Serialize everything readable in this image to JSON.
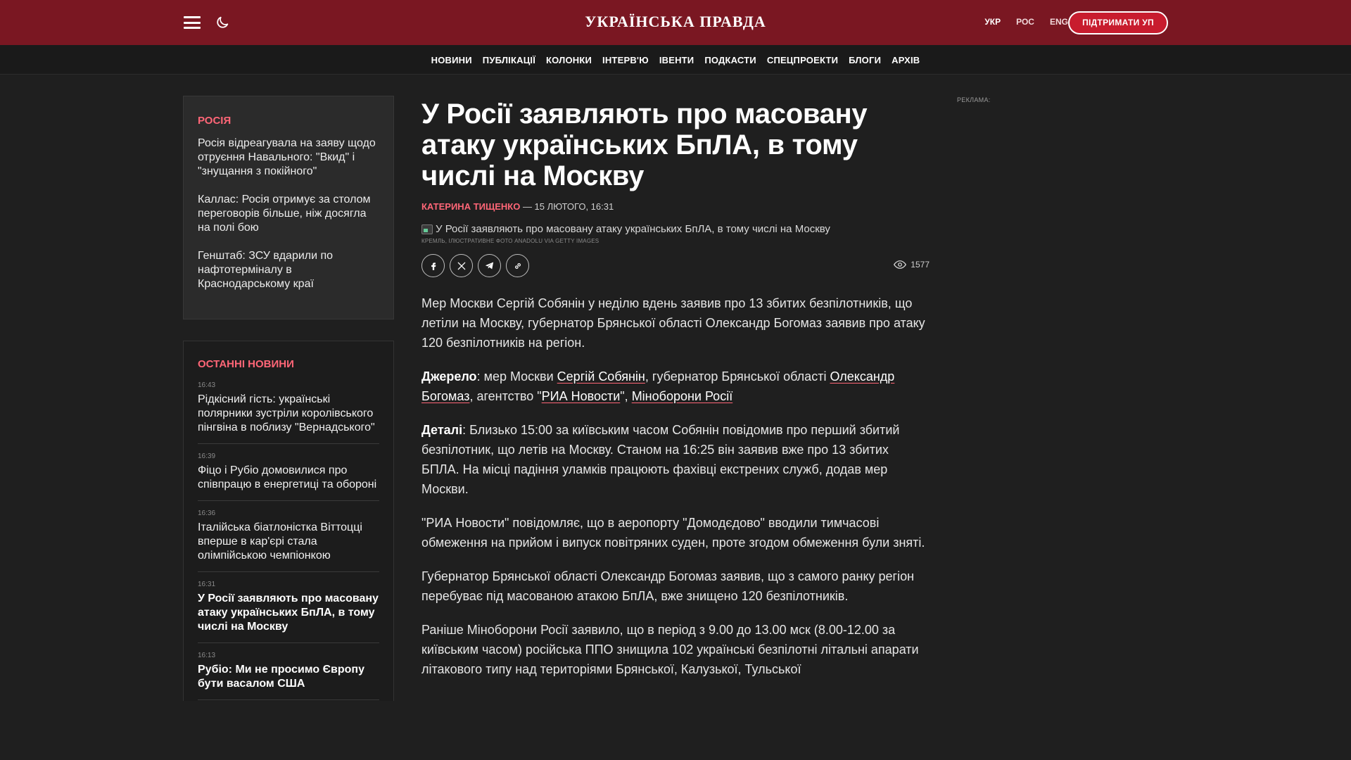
{
  "header": {
    "logo": "УКРАЇНСЬКА ПРАВДА",
    "langs": [
      "УКР",
      "РОС",
      "ENG"
    ],
    "support_label": "ПІДТРИМАТИ УП"
  },
  "nav": {
    "items": [
      "НОВИНИ",
      "ПУБЛІКАЦІЇ",
      "КОЛОНКИ",
      "ІНТЕРВ'Ю",
      "ІВЕНТИ",
      "ПОДКАСТИ",
      "СПЕЦПРОЕКТИ",
      "БЛОГИ",
      "АРХІВ"
    ]
  },
  "category": {
    "title": "РОСІЯ",
    "items": [
      "Росія відреагувала на заяву щодо отруєння Навального: \"Вкид\" і \"знущання з покійного\"",
      "Каллас: Росія отримує за столом переговорів більше, ніж досягла на полі бою",
      "Генштаб: ЗСУ вдарили по нафтотерміналу в Краснодарському краї"
    ]
  },
  "latest": {
    "title": "ОСТАННІ НОВИНИ",
    "items": [
      {
        "time": "16:43",
        "headline": "Рідкісний гість: українські полярники зустріли королівського пінгвіна в поблизу \"Вернадського\""
      },
      {
        "time": "16:39",
        "headline": "Фіцо і Рубіо домовилися про співпрацю в енергетиці та обороні"
      },
      {
        "time": "16:36",
        "headline": "Італійська біатлоністка Віттоцці вперше в кар'єрі стала олімпійською чемпіонкою"
      },
      {
        "time": "16:31",
        "headline": "У Росії заявляють про масовану атаку українських БпЛА, в тому числі на Москву"
      },
      {
        "time": "16:13",
        "headline": "Рубіо: Ми не просимо Європу бути васалом США"
      }
    ]
  },
  "article": {
    "title": "У Росії заявляють про масовану атаку українських БпЛА, в тому числі на Москву",
    "author": "КАТЕРИНА ТИЩЕНКО",
    "date": " — 15 ЛЮТОГО, 16:31",
    "image_alt": "У Росії заявляють про масовану атаку українських БпЛА, в тому числі на Москву",
    "caption": "Кремль, ілюстративне фото Anadolu via Getty Images",
    "views": "1577",
    "lead": "Мер Москви Сергій Собянін у неділю вдень заявив про 13 збитих безпілотників, що летіли на Москву, губернатор Брянської області Олександр Богомаз заявив про атаку 120 безпілотників на регіон.",
    "source_label": "Джерело",
    "source_text_1": ": мер Москви ",
    "source_link_1": "Сергій Собянін",
    "source_text_2": ", губернатор Брянської області ",
    "source_link_2": "Олександр Богомаз",
    "source_text_3": ", агентство \"",
    "source_link_3": "РИА Новости",
    "source_text_4": "\", ",
    "source_link_4": "Міноборони Росії",
    "details_label": "Деталі",
    "details_text": ": Близько 15:00 за київським часом Собянін повідомив про перший збитий безпілотник, що летів на Москву. Станом на 16:25 він заявив вже про 13 збитих БПЛА. На місці падіння уламків працюють фахівці екстрених служб, додав мер Москви.",
    "p3": "\"РИА Новости\" повідомляє, що в аеропорту \"Домодєдово\" вводили тимчасові обмеження на прийом і випуск повітряних суден, проте згодом обмеження були зняті.",
    "p4": "Губернатор Брянської області Олександр Богомаз заявив, що з самого ранку регіон перебуває під масованою атакою БпЛА, вже знищено 120 безпілотників.",
    "p5": "Раніше Міноборони Росії заявило, що в період з 9.00 до 13.00 мск (8.00-12.00 за київським часом) російська ППО знищила 102 українські безпілотні літальні апарати літакового типу над територіями Брянської, Калузької, Тульської"
  },
  "ad_label": "Реклама:",
  "colors": {
    "brand": "#7a1722",
    "accent": "#ff6677",
    "button": "#c81c2e",
    "background": "#1f1f1f"
  },
  "icons": [
    "menu-icon",
    "moon-icon",
    "facebook-icon",
    "x-icon",
    "telegram-icon",
    "link-icon",
    "eye-icon",
    "broken-image-icon"
  ]
}
